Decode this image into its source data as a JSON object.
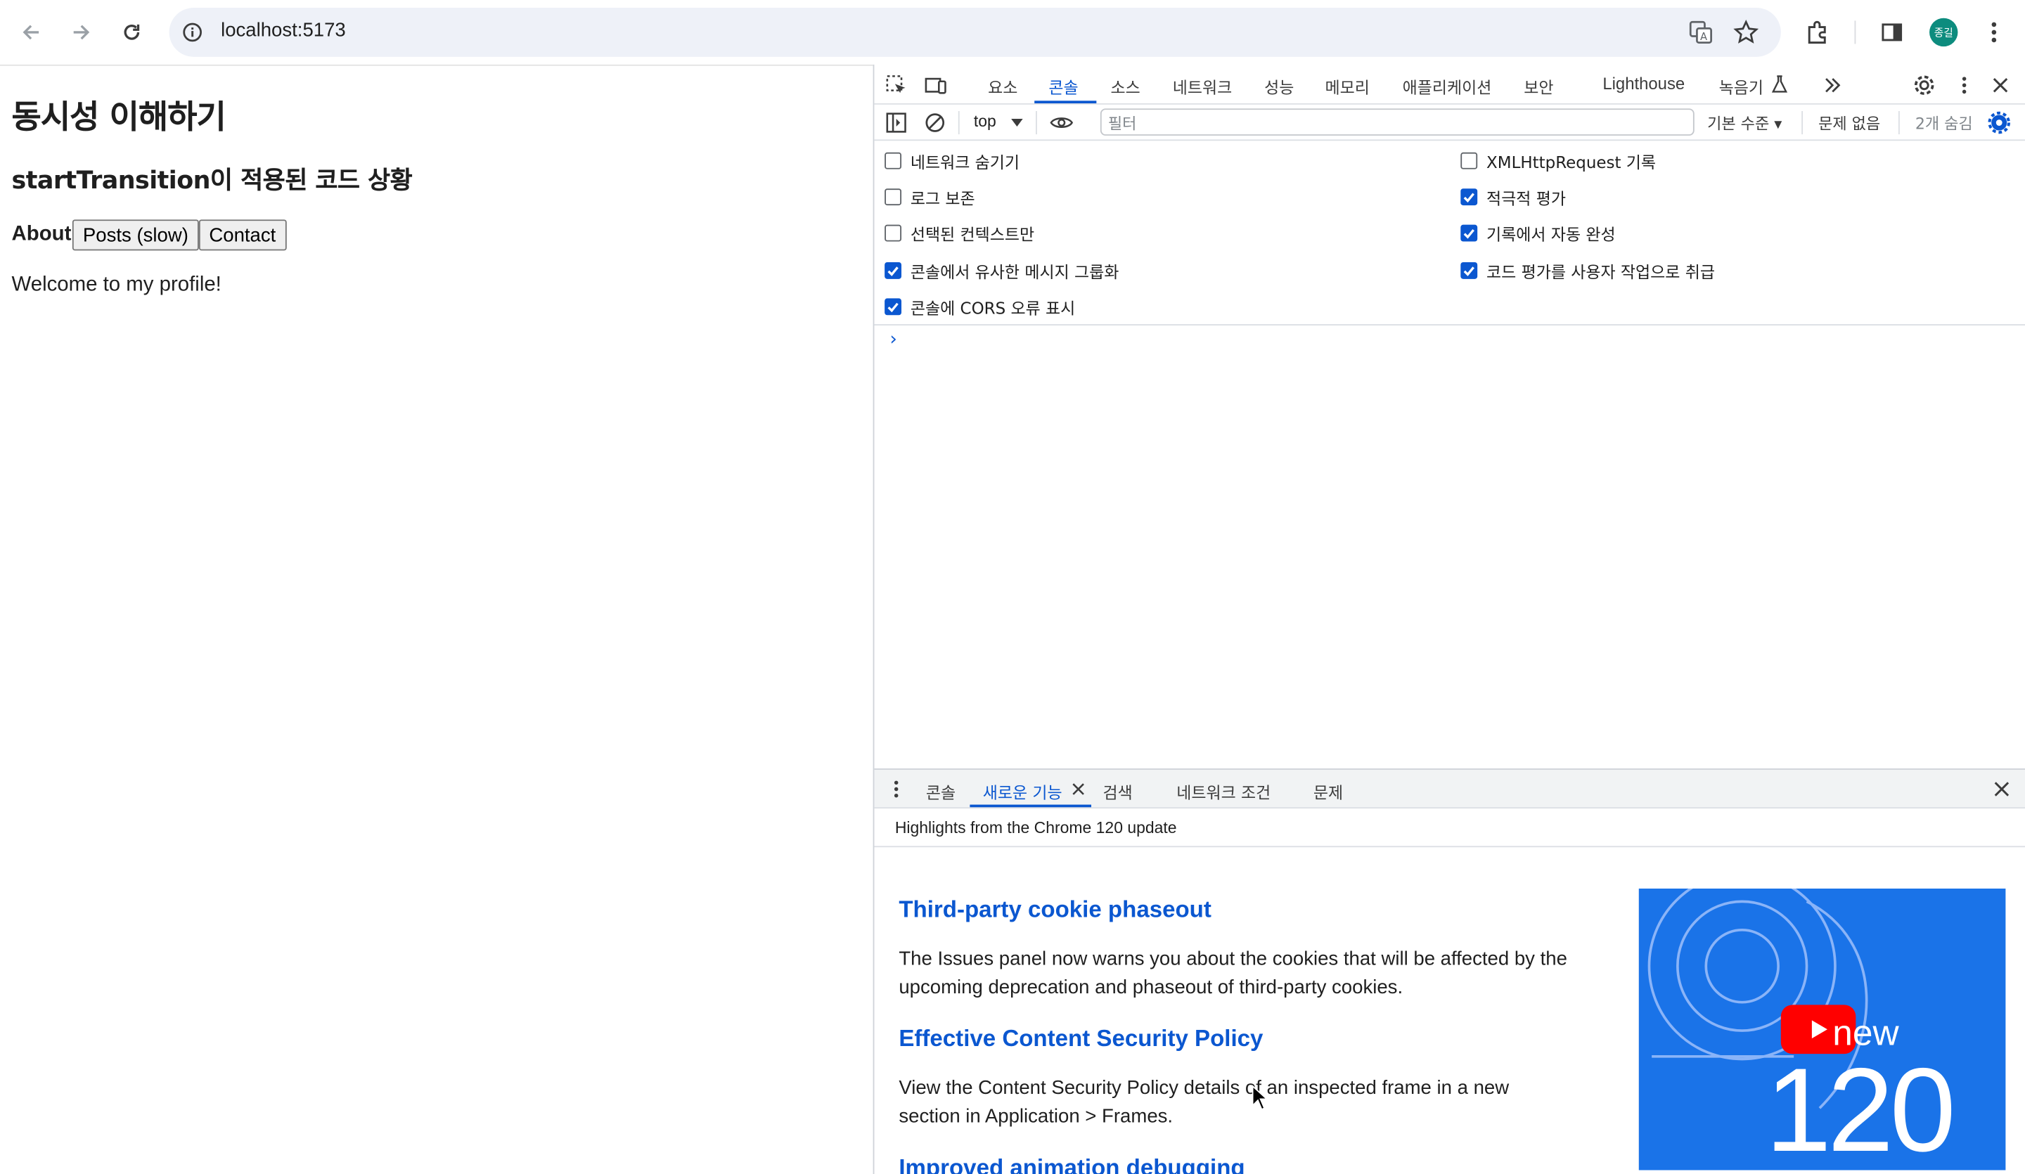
{
  "browser": {
    "url": "localhost:5173",
    "avatar_text": "종길"
  },
  "page": {
    "title": "동시성 이해하기",
    "subtitle": "startTransition이 적용된 코드 상황",
    "tab_about": "About",
    "tab_posts": "Posts (slow)",
    "tab_contact": "Contact",
    "content": "Welcome to my profile!"
  },
  "devtools": {
    "tabs": [
      "요소",
      "콘솔",
      "소스",
      "네트워크",
      "성능",
      "메모리",
      "애플리케이션",
      "보안",
      "Lighthouse",
      "녹음기"
    ],
    "active_tab": "콘솔",
    "console_bar": {
      "context": "top",
      "filter_placeholder": "필터",
      "level": "기본 수준 ▾",
      "issues": "문제 없음",
      "hidden": "2개 숨김"
    },
    "settings_left": [
      {
        "label": "네트워크 숨기기",
        "checked": false
      },
      {
        "label": "로그 보존",
        "checked": false
      },
      {
        "label": "선택된 컨텍스트만",
        "checked": false
      },
      {
        "label": "콘솔에서 유사한 메시지 그룹화",
        "checked": true
      },
      {
        "label": "콘솔에 CORS 오류 표시",
        "checked": true
      }
    ],
    "settings_right": [
      {
        "label": "XMLHttpRequest 기록",
        "checked": false
      },
      {
        "label": "적극적 평가",
        "checked": true
      },
      {
        "label": "기록에서 자동 완성",
        "checked": true
      },
      {
        "label": "코드 평가를 사용자 작업으로 취급",
        "checked": true
      }
    ],
    "prompt": "›",
    "drawer": {
      "tabs": [
        "콘솔",
        "새로운 기능",
        "검색",
        "네트워크 조건",
        "문제"
      ],
      "active_tab": "새로운 기능",
      "header": "Highlights from the Chrome 120 update",
      "features": [
        {
          "title": "Third-party cookie phaseout",
          "desc": "The Issues panel now warns you about the cookies that will be affected by the upcoming deprecation and phaseout of third-party cookies."
        },
        {
          "title": "Effective Content Security Policy",
          "desc": "View the Content Security Policy details of an inspected frame in a new section in Application > Frames."
        },
        {
          "title": "Improved animation debugging",
          "desc": ""
        }
      ],
      "thumb_new": "new",
      "thumb_version": "120"
    }
  },
  "colors": {
    "accent": "#0b57d0",
    "thumb_bg": "#1a73e8",
    "play_red": "#ff0000"
  }
}
